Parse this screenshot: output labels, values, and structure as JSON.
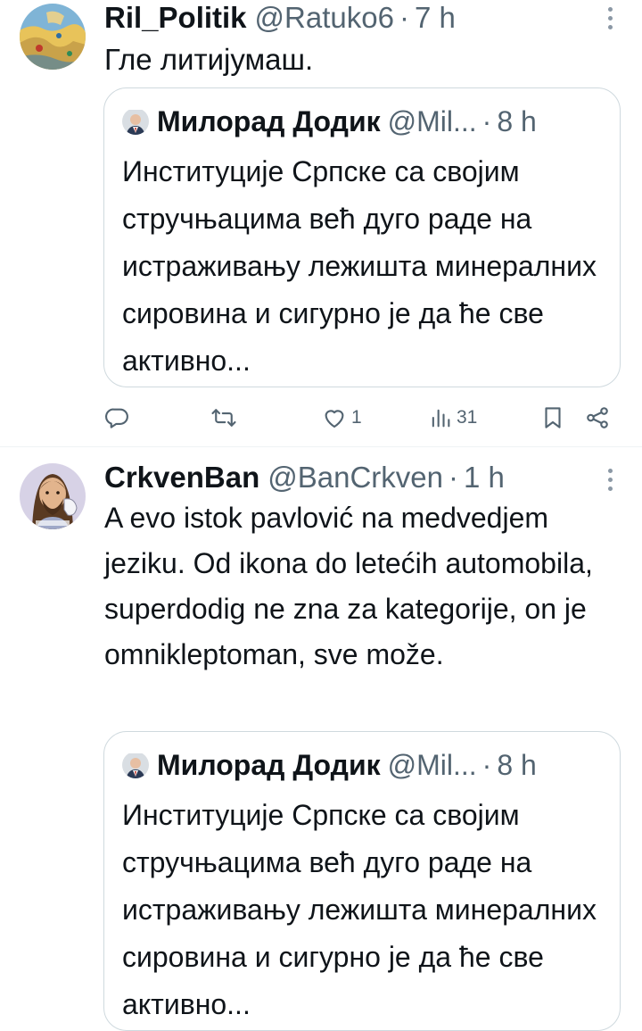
{
  "tweets": [
    {
      "name": "Ril_Politik",
      "handle": "@Ratuko6",
      "dot": "·",
      "time": "7 h",
      "text": "Гле литијумаш.",
      "quote": {
        "name": "Милорад Додик",
        "handle": "@Mil...",
        "dot": "·",
        "time": "8 h",
        "text": "Институције Српске са својим стручњацима већ дуго раде на истраживању лежишта минералних сировина и сигурно је да ће све активно..."
      },
      "actions": {
        "replies": "",
        "retweets": "",
        "likes": "1",
        "views": "31"
      }
    },
    {
      "name": "CrkvenBan",
      "handle": "@BanCrkven",
      "dot": "·",
      "time": "1 h",
      "text": "A evo istok pavlović na medvedjem jeziku. Od ikona do letećih automobila, superdodig ne zna za kategorije, on je omniklepto­man, sve može.",
      "quote": {
        "name": "Милорад Додик",
        "handle": "@Mil...",
        "dot": "·",
        "time": "8 h",
        "text": "Институције Српске са својим стручњацима већ дуго раде на истраживању лежишта минералних сировина и сигурно је да ће све активно..."
      }
    }
  ],
  "colors": {
    "text": "#0f1419",
    "secondary": "#536471",
    "border": "#cfd9de",
    "divider": "#eff3f4"
  },
  "icons": [
    "reply-icon",
    "retweet-icon",
    "like-icon",
    "views-icon",
    "bookmark-icon",
    "share-icon",
    "more-icon"
  ]
}
